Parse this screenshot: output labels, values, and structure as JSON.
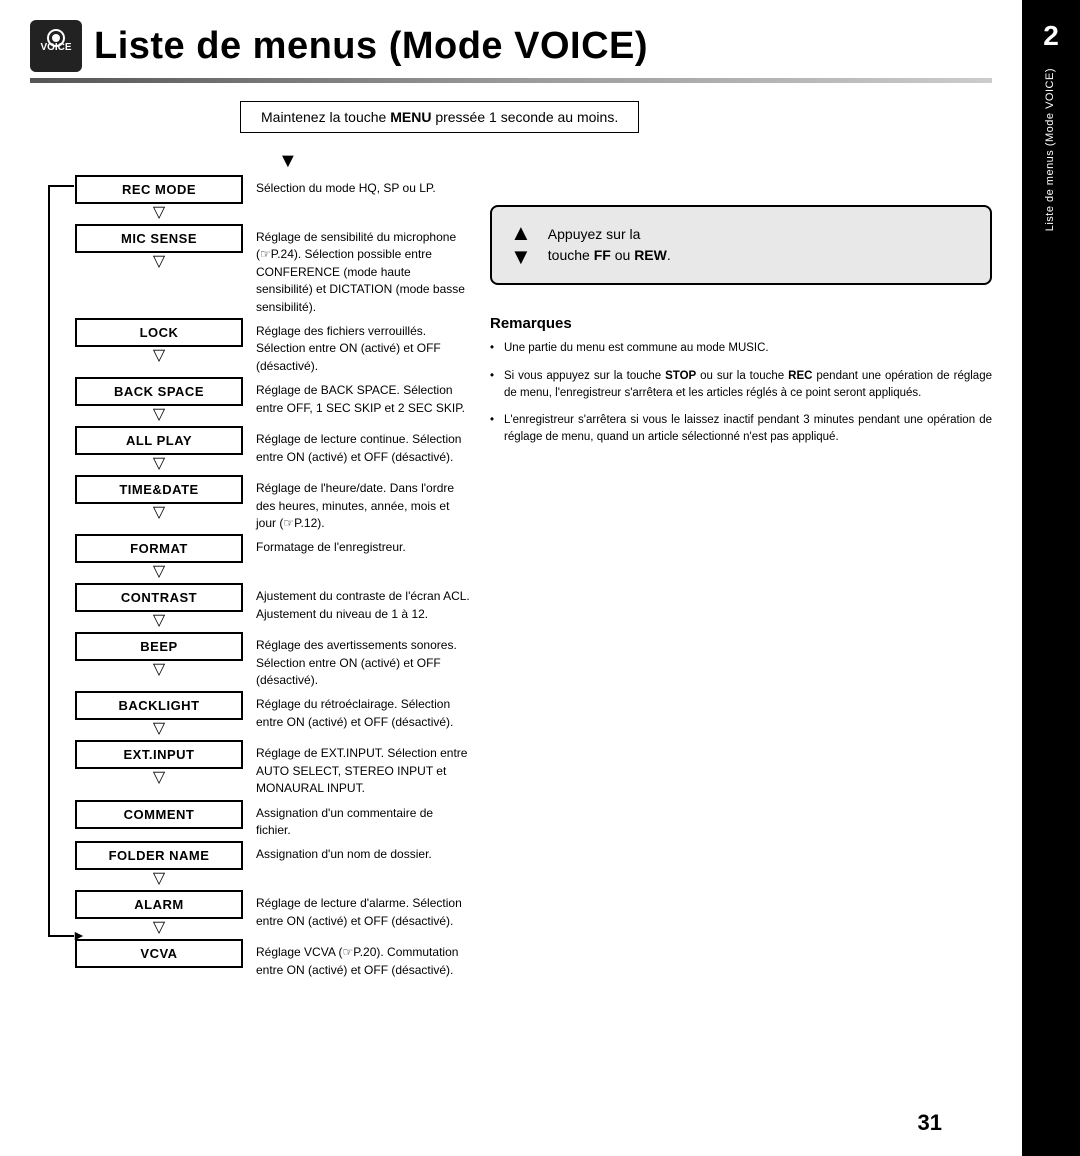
{
  "page": {
    "title": "Liste de menus (Mode VOICE)",
    "sidebar_number": "2",
    "sidebar_text": "Liste de menus (Mode VOICE)",
    "page_number": "31"
  },
  "header": {
    "instruction": "Maintenez la touche MENU pressée 1 seconde au moins.",
    "instruction_plain": "Maintenez la touche ",
    "instruction_bold": "MENU",
    "instruction_end": " pressée 1 seconde au moins."
  },
  "menu_items": [
    {
      "label": "REC MODE",
      "description": "Sélection du mode HQ, SP ou LP.",
      "has_arrow_below": true
    },
    {
      "label": "MIC SENSE",
      "description": "Réglage de sensibilité du microphone (☞P.24). Sélection possible entre CONFERENCE (mode haute sensibilité) et DICTATION (mode basse sensibilité).",
      "has_arrow_below": true
    },
    {
      "label": "LOCK",
      "description": "Réglage des fichiers verrouillés. Sélection entre ON (activé) et OFF (désactivé).",
      "has_arrow_below": true
    },
    {
      "label": "BACK SPACE",
      "description": "Réglage de BACK SPACE. Sélection entre OFF, 1 SEC SKIP et 2 SEC SKIP.",
      "has_arrow_below": true
    },
    {
      "label": "ALL PLAY",
      "description": "Réglage de lecture continue. Sélection entre ON (activé) et OFF (désactivé).",
      "has_arrow_below": true
    },
    {
      "label": "TIME&DATE",
      "description": "Réglage de l'heure/date. Dans l'ordre des heures, minutes, année, mois et jour (☞P.12).",
      "has_arrow_below": true
    },
    {
      "label": "FORMAT",
      "description": "Formatage de l'enregistreur.",
      "has_arrow_below": true
    },
    {
      "label": "CONTRAST",
      "description": "Ajustement du contraste de l'écran ACL. Ajustement du niveau de 1 à 12.",
      "has_arrow_below": true
    },
    {
      "label": "BEEP",
      "description": "Réglage des avertissements sonores. Sélection entre ON (activé) et OFF (désactivé).",
      "has_arrow_below": true
    },
    {
      "label": "BACKLIGHT",
      "description": "Réglage du rétroéclairage. Sélection entre ON (activé) et OFF (désactivé).",
      "has_arrow_below": true
    },
    {
      "label": "EXT.INPUT",
      "description": "Réglage de EXT.INPUT. Sélection entre AUTO SELECT, STEREO INPUT et MONAURAL INPUT.",
      "has_arrow_below": true
    },
    {
      "label": "COMMENT",
      "description": "Assignation d'un commentaire de fichier.",
      "has_arrow_below": false
    },
    {
      "label": "FOLDER NAME",
      "description": "Assignation d'un nom de dossier.",
      "has_arrow_below": true
    },
    {
      "label": "ALARM",
      "description": "Réglage de lecture d'alarme. Sélection entre ON (activé) et OFF (désactivé).",
      "has_arrow_below": true
    },
    {
      "label": "VCVA",
      "description": "Réglage VCVA (☞P.20). Commutation entre ON (activé) et OFF (désactivé).",
      "has_arrow_below": false,
      "is_last": true
    }
  ],
  "ff_rew_box": {
    "line1": "Appuyez sur la",
    "line2": "touche FF ou REW.",
    "ff_bold": "FF",
    "rew_bold": "REW"
  },
  "remarks": {
    "title": "Remarques",
    "items": [
      "Une partie du menu est commune au mode MUSIC.",
      "Si vous appuyez sur la touche STOP ou sur la touche REC pendant une opération de réglage de menu, l'enregistreur s'arrêtera et les articles réglés à ce point seront appliqués.",
      "L'enregistreur s'arrêtera si vous le laissez inactif pendant 3 minutes pendant une opération de réglage de menu, quand un article sélectionné n'est pas appliqué."
    ]
  }
}
